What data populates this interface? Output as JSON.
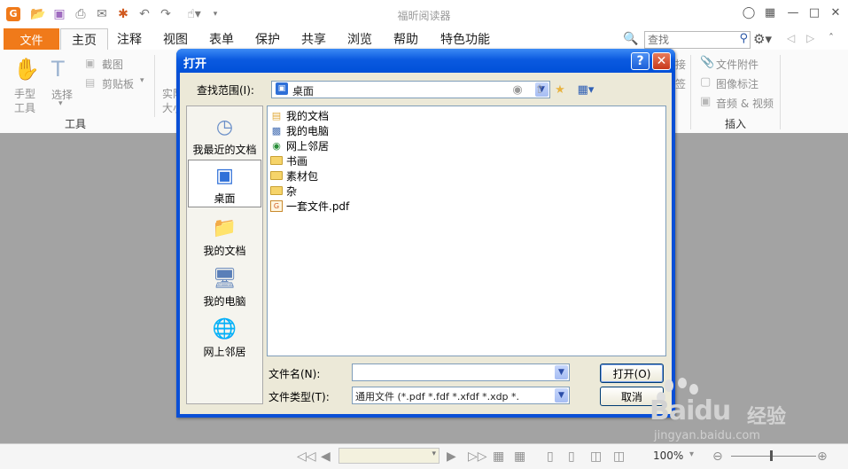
{
  "app": {
    "title": "福昕阅读器"
  },
  "menu": {
    "file": "文件",
    "tabs": [
      "主页",
      "注释",
      "视图",
      "表单",
      "保护",
      "共享",
      "浏览",
      "帮助",
      "特色功能"
    ],
    "active_tab": "主页",
    "search_placeholder": "查找"
  },
  "ribbon": {
    "hand_tool": "手型\n工具",
    "select_tool": "选择",
    "screenshot": "截图",
    "clipboard": "剪贴板",
    "actual_size_partial": "实际\n大小",
    "group_tools": "工具",
    "file_attachment": "文件附件",
    "image_annotation": "图像标注",
    "audio_video": "音频 & 视频",
    "group_insert": "插入",
    "partial_right_1": "接",
    "partial_right_2": "签"
  },
  "dialog": {
    "title": "打开",
    "lookin_label": "查找范围(I):",
    "lookin_value": "桌面",
    "places": [
      {
        "label": "我最近的文档",
        "icon": "recent-docs-icon"
      },
      {
        "label": "桌面",
        "icon": "desktop-icon",
        "selected": true
      },
      {
        "label": "我的文档",
        "icon": "my-documents-icon"
      },
      {
        "label": "我的电脑",
        "icon": "my-computer-icon"
      },
      {
        "label": "网上邻居",
        "icon": "network-places-icon"
      }
    ],
    "files": [
      {
        "name": "我的文档",
        "icon": "my-documents-icon"
      },
      {
        "name": "我的电脑",
        "icon": "my-computer-icon"
      },
      {
        "name": "网上邻居",
        "icon": "network-places-icon"
      },
      {
        "name": "书画",
        "icon": "folder-icon"
      },
      {
        "name": "素材包",
        "icon": "folder-icon"
      },
      {
        "name": "杂",
        "icon": "folder-icon"
      },
      {
        "name": "一套文件.pdf",
        "icon": "pdf-file-icon"
      }
    ],
    "filename_label": "文件名(N):",
    "filename_value": "",
    "filetype_label": "文件类型(T):",
    "filetype_value": "通用文件 (*.pdf *.fdf *.xfdf *.xdp *.",
    "open_button": "打开(O)",
    "cancel_button": "取消"
  },
  "statusbar": {
    "zoom": "100%"
  },
  "watermark": {
    "brand": "Baidu",
    "sub": "经验",
    "url": "jingyan.baidu.com"
  }
}
